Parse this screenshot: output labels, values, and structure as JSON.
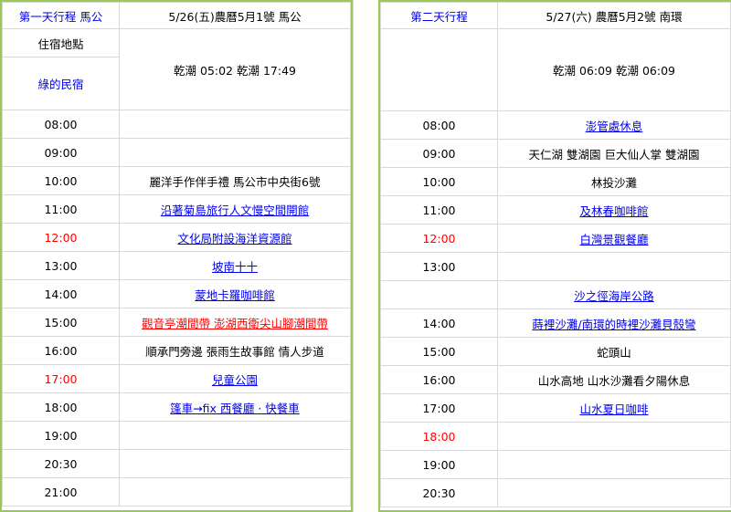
{
  "day1": {
    "title": "第一天行程 馬公",
    "date": "5/26(五)農曆5月1號  馬公",
    "lodging_label": "住宿地點",
    "lodging_name": "綠的民宿",
    "tide": "乾潮   05:02  乾潮   17:49",
    "rows": [
      {
        "time": "08:00",
        "time_red": false,
        "text": "",
        "style": "plain"
      },
      {
        "time": "09:00",
        "time_red": false,
        "text": "",
        "style": "plain"
      },
      {
        "time": "10:00",
        "time_red": false,
        "text": "麗洋手作伴手禮   馬公市中央街6號",
        "style": "plain"
      },
      {
        "time": "11:00",
        "time_red": false,
        "text": "沿著菊島旅行人文慢空間開館",
        "style": "link"
      },
      {
        "time": "12:00",
        "time_red": true,
        "text": "文化局附設海洋資源館",
        "style": "link"
      },
      {
        "time": "13:00",
        "time_red": false,
        "text": "坡南十十",
        "style": "link"
      },
      {
        "time": "14:00",
        "time_red": false,
        "text": "蒙地卡羅咖啡館",
        "style": "link"
      },
      {
        "time": "15:00",
        "time_red": false,
        "text": "觀音亭潮間帶    澎湖西衛尖山腳潮間帶",
        "style": "red"
      },
      {
        "time": "16:00",
        "time_red": false,
        "text": "順承門旁邊  張雨生故事館 情人步道",
        "style": "plain"
      },
      {
        "time": "17:00",
        "time_red": true,
        "text": "兒童公園",
        "style": "link"
      },
      {
        "time": "18:00",
        "time_red": false,
        "text": "篷車→fix 西餐廳 · 快餐車",
        "style": "link"
      },
      {
        "time": "19:00",
        "time_red": false,
        "text": "",
        "style": "plain"
      },
      {
        "time": "20:30",
        "time_red": false,
        "text": "",
        "style": "plain"
      },
      {
        "time": "21:00",
        "time_red": false,
        "text": "",
        "style": "plain"
      }
    ]
  },
  "day2": {
    "title": "第二天行程",
    "date": "5/27(六) 農曆5月2號  南環",
    "tide": "乾潮   06:09  乾潮   06:09",
    "rows": [
      {
        "time": "08:00",
        "time_red": false,
        "text": "澎管處休息",
        "style": "link"
      },
      {
        "time": "09:00",
        "time_red": false,
        "text": "天仁湖  雙湖園  巨大仙人掌  雙湖園",
        "style": "plain"
      },
      {
        "time": "10:00",
        "time_red": false,
        "text": "林投沙灘",
        "style": "plain"
      },
      {
        "time": "11:00",
        "time_red": false,
        "text": "及林春咖啡館",
        "style": "link"
      },
      {
        "time": "12:00",
        "time_red": true,
        "text": "白灣景觀餐廳",
        "style": "link"
      },
      {
        "time": "13:00",
        "time_red": false,
        "text": "",
        "style": "plain"
      },
      {
        "time": "",
        "time_red": false,
        "text": "沙之徑海岸公路",
        "style": "link"
      },
      {
        "time": "14:00",
        "time_red": false,
        "text": "蒔裡沙灘/南環的時裡沙灘貝殼彎",
        "style": "link"
      },
      {
        "time": "15:00",
        "time_red": false,
        "text": "蛇頭山",
        "style": "plain"
      },
      {
        "time": "16:00",
        "time_red": false,
        "text": "山水高地  山水沙灘看夕陽休息",
        "style": "plain"
      },
      {
        "time": "17:00",
        "time_red": false,
        "text": "山水夏日咖啡",
        "style": "link"
      },
      {
        "time": "18:00",
        "time_red": true,
        "text": "",
        "style": "plain"
      },
      {
        "time": "19:00",
        "time_red": false,
        "text": "",
        "style": "plain"
      },
      {
        "time": "20:30",
        "time_red": false,
        "text": "",
        "style": "plain"
      }
    ]
  },
  "colors": {
    "border_green": "#98c957",
    "grid": "#d9d9d9",
    "link_blue": "#0000ee",
    "red": "#ff0000"
  }
}
